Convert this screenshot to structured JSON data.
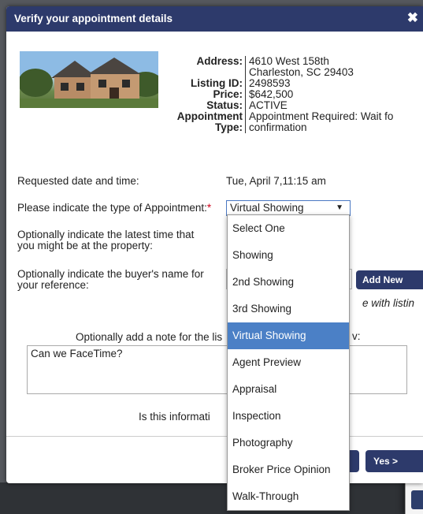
{
  "dialog": {
    "title": "Verify your appointment details",
    "close_glyph": "✖"
  },
  "listing": {
    "address_label": "Address:",
    "address_line1": "4610 West 158th",
    "address_line2": "Charleston, SC 29403",
    "listing_id_label": "Listing ID:",
    "listing_id": "2498593",
    "price_label": "Price:",
    "price": "$642,500",
    "status_label": "Status:",
    "status": "ACTIVE",
    "appt_type_label_1": "Appointment",
    "appt_type_label_2": "Type:",
    "appt_type_line1": "Appointment Required: Wait fo",
    "appt_type_line2": "confirmation"
  },
  "form": {
    "requested_label": "Requested date and time:",
    "requested_value": "Tue, April 7,11:15 am",
    "type_label": "Please indicate the type of Appointment:",
    "required_mark": "*",
    "type_selected": "Virtual Showing",
    "latest_time_label_1": "Optionally indicate the latest time that",
    "latest_time_label_2": "you might be at the property:",
    "buyer_label_1": "Optionally indicate the buyer's name for",
    "buyer_label_2": "your reference:",
    "add_new_label": "Add New",
    "shared_note": "e with listin",
    "note_label": "Optionally add a note for the lis",
    "note_label_tail": "v:",
    "note_value": "Can we FaceTime?",
    "confirm_question": "Is this informati",
    "yes_label": "Yes >"
  },
  "dropdown": {
    "options": [
      "Select One",
      "Showing",
      "2nd Showing",
      "3rd Showing",
      "Virtual Showing",
      "Agent Preview",
      "Appraisal",
      "Inspection",
      "Photography",
      "Broker Price Opinion",
      "Walk-Through"
    ],
    "selected": "Virtual Showing"
  },
  "colors": {
    "titlebar": "#2d3a6b",
    "button": "#2d3a6b",
    "selected_option": "#4b80c6",
    "required": "#d0021b"
  }
}
